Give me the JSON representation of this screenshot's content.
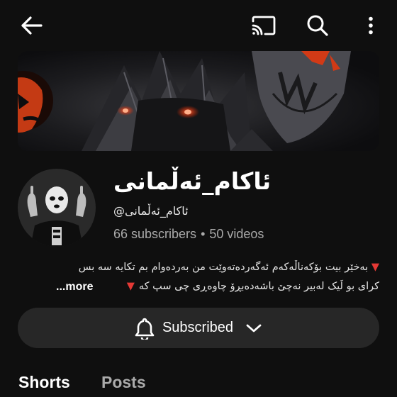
{
  "channel": {
    "title": "ئاکام_ئەڵمانی",
    "handle": "@ئاکام_ئەڵمانی",
    "subscribers": "66 subscribers",
    "separator": "•",
    "videos": "50 videos"
  },
  "description": {
    "line1": "بەخێر بیت بۆکەناڵەکەم ئەگەردەتەوێت من بەردەوام بم تکایە سە بس",
    "line2": "کرای بو لَیک لەبیر نەچێ باشەدەبڕۆ چاوەڕی چی سپ کە",
    "more": "...more",
    "marker_color": "#e53935"
  },
  "subscribe_button": {
    "label": "Subscribed"
  },
  "tabs": [
    {
      "label": "Shorts",
      "active": true
    },
    {
      "label": "Posts",
      "active": false
    }
  ],
  "icons": {
    "back": "arrow-left-icon",
    "cast": "cast-icon",
    "search": "search-icon",
    "more": "more-vertical-icon",
    "bell": "bell-icon",
    "chevron": "chevron-down-icon"
  },
  "colors": {
    "background": "#0f0f0f",
    "button_bg": "#272727",
    "secondary_text": "#aaaaaa"
  }
}
